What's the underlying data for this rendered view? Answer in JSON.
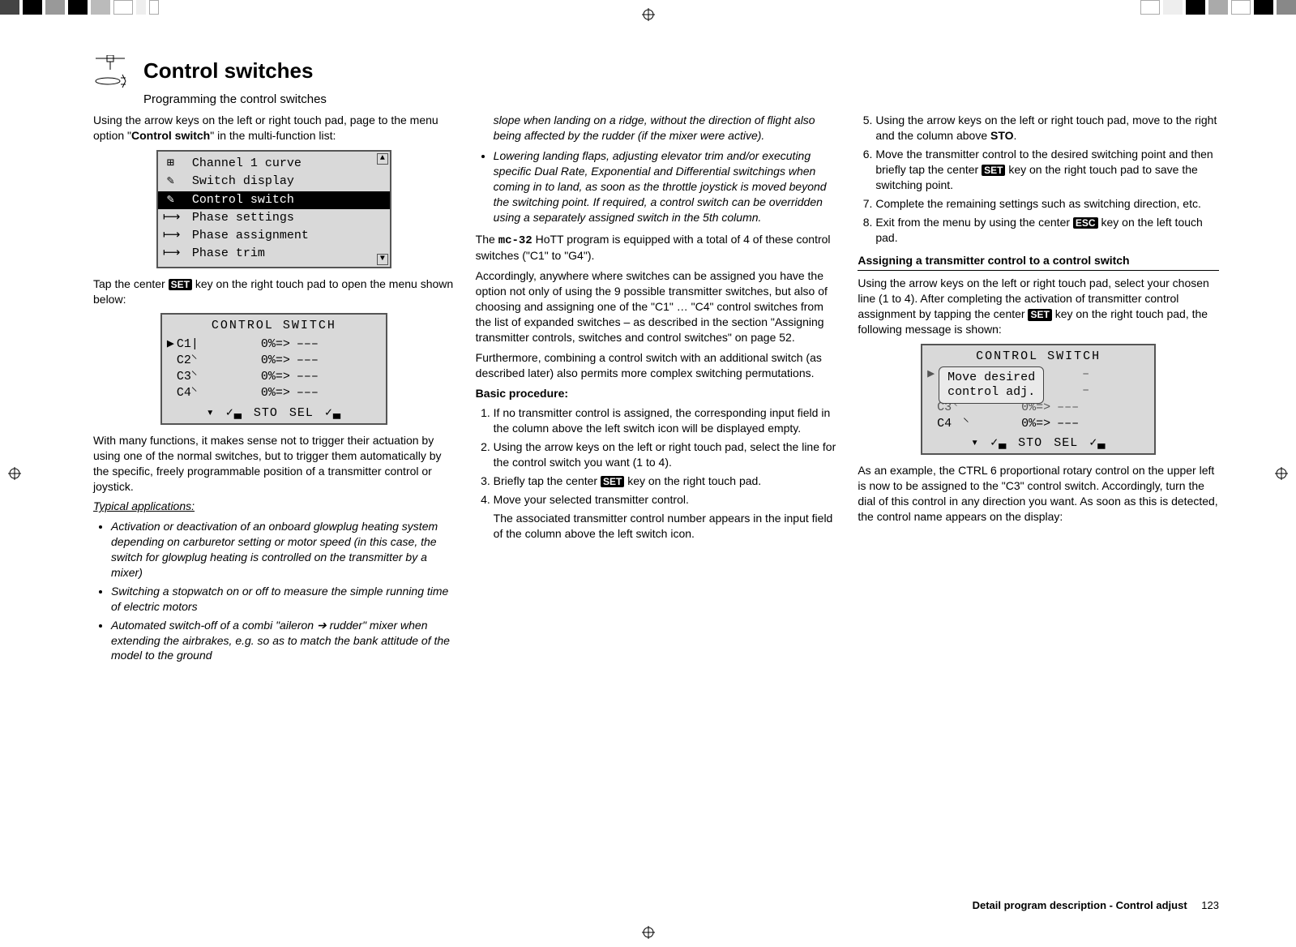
{
  "page": {
    "title": "Control switches",
    "subtitle": "Programming the control switches",
    "footer_label": "Detail program description - Control adjust",
    "page_number": "123"
  },
  "col1": {
    "intro_p1_a": "Using the arrow keys on the left or right touch pad, page to the menu option \"",
    "intro_p1_b": "Control switch",
    "intro_p1_c": "\" in the multi-function list:",
    "menu": {
      "items": [
        "Channel 1 curve",
        "Switch display",
        "Control switch",
        "Phase settings",
        "Phase assignment",
        "Phase trim"
      ],
      "selected_index": 2
    },
    "p2_a": "Tap the center ",
    "p2_key": "SET",
    "p2_b": " key on the right touch pad to open the menu shown below:",
    "lcd2": {
      "title": "CONTROL  SWITCH",
      "rows": [
        {
          "label": "C1",
          "val": "0%",
          "arrow": "=>",
          "dash": "–––",
          "marker": "▶",
          "glyph": "|"
        },
        {
          "label": "C2",
          "val": "0%",
          "arrow": "=>",
          "dash": "–––",
          "marker": "",
          "glyph": "⸌"
        },
        {
          "label": "C3",
          "val": "0%",
          "arrow": "=>",
          "dash": "–––",
          "marker": "",
          "glyph": "⸌"
        },
        {
          "label": "C4",
          "val": "0%",
          "arrow": "=>",
          "dash": "–––",
          "marker": "",
          "glyph": "⸌"
        }
      ],
      "bottom": [
        "▾",
        "✓▃",
        "STO",
        "SEL",
        "✓▃"
      ]
    },
    "p3": "With many functions, it makes sense not to trigger their actuation by using one of the normal switches, but to trigger them automatically by the specific, freely programmable position of a transmitter control or joystick.",
    "apps_head": "Typical applications:",
    "apps": [
      "Activation or deactivation of an onboard glowplug heating system depending on carburetor setting or motor speed (in this case, the switch for glowplug heating is controlled on the transmitter by a mixer)",
      "Switching a stopwatch on or off to measure the simple running time of electric motors",
      "Automated switch-off of a combi \"aileron ➔ rudder\" mixer when extending the airbrakes, e.g. so as to match the bank attitude of the model to the ground"
    ]
  },
  "col2": {
    "carry_italic": "slope when landing on a ridge, without the direction of flight also being affected by the rudder (if the mixer were active).",
    "bullet2": "Lowering landing flaps, adjusting elevator trim and/or executing specific Dual Rate, Exponential and Differential switchings when coming in to land, as soon as the throttle joystick is moved beyond the switching point. If required, a control switch can be overridden using a separately assigned switch in the 5th column.",
    "p_a": "The ",
    "p_model": "mc-32",
    "p_b": " HoTT program is equipped with a total of 4 of these control switches (\"C1\" to \"G4\").",
    "p2": "Accordingly, anywhere where switches can be assigned you have the option not only of using the 9 possible transmitter switches, but also of choosing and assigning one of the \"C1\" … \"C4\" control switches from the list of expanded switches – as described in the section \"Assigning transmitter controls, switches and control switches\" on page 52.",
    "p3": "Furthermore, combining a control switch with an additional switch (as described later) also permits more complex switching permutations.",
    "bp_head": "Basic procedure:",
    "ol": [
      "If no transmitter control is assigned, the corresponding input field in the column above the left switch icon will be displayed empty.",
      "Using the arrow keys on the left or right touch pad, select the line for the control switch you want (1 to 4).",
      "Briefly tap the center ",
      "Move your selected transmitter control."
    ],
    "ol3_key": "SET",
    "ol3_b": " key on the right touch pad.",
    "ol_tail": "The associated transmitter control number appears in the input field of the column above the left switch icon."
  },
  "col3": {
    "ol5_a": "Using the arrow keys on the left or right touch pad, move to the right and the column above ",
    "ol5_b": "STO",
    "ol5_c": ".",
    "ol6_a": "Move the transmitter control to the desired switching point and then briefly tap the center ",
    "ol6_key": "SET",
    "ol6_b": " key on the right touch pad to save the switching point.",
    "ol7": "Complete the remaining settings such as switching direction, etc.",
    "ol8_a": "Exit from the menu by using the center ",
    "ol8_key": "ESC",
    "ol8_b": " key on the left touch pad.",
    "sec_head": "Assigning a transmitter control to a control switch",
    "p1_a": "Using the arrow keys on the left or right touch pad, select your chosen line (1 to 4). After completing the activation of transmitter control assignment by tapping the center ",
    "p1_key": "SET",
    "p1_b": " key on the right touch pad, the following message is shown:",
    "lcd": {
      "title": "CONTROL  SWITCH",
      "overlay_l1": "Move  desired",
      "overlay_l2": "control  adj.",
      "row3": {
        "label": "C3",
        "val": "0%",
        "arrow": "=>",
        "dash": "–––"
      },
      "row4": {
        "label": "C4",
        "val": "0%",
        "arrow": "=>",
        "dash": "–––"
      },
      "bottom": [
        "▾",
        "✓▃",
        "STO",
        "SEL",
        "✓▃"
      ]
    },
    "p2": "As an example, the CTRL 6 proportional rotary control on the upper left is now to be assigned to the \"C3\" control switch. Accordingly, turn the dial of this control in any direction you want. As soon as this is detected, the control name appears on the display:"
  }
}
